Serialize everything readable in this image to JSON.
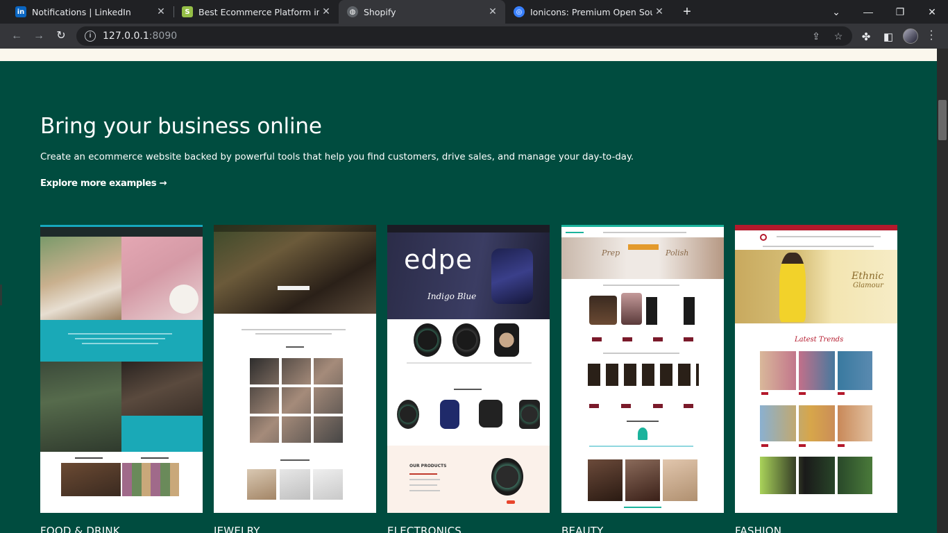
{
  "browser": {
    "tabs": [
      {
        "title": "Notifications | LinkedIn",
        "favicon": "linkedin-icon"
      },
      {
        "title": "Best Ecommerce Platform in India",
        "favicon": "shopify-icon"
      },
      {
        "title": "Shopify",
        "favicon": "globe-icon"
      },
      {
        "title": "Ionicons: Premium Open Source Icons",
        "favicon": "ionicons-icon"
      }
    ],
    "url_host": "127.0.0.1",
    "url_port": ":8090"
  },
  "hero": {
    "headline": "Bring your business online",
    "subline": "Create an ecommerce website backed by powerful tools that help you find customers, drive sales, and manage your day-to-day.",
    "explore_link": "Explore more examples →"
  },
  "examples": [
    {
      "category": "FOOD & DRINK"
    },
    {
      "category": "JEWELRY"
    },
    {
      "category": "ELECTRONICS",
      "hero_brand": "edpe",
      "hero_tag": "Indigo Blue",
      "products_heading": "OUR PRODUCTS"
    },
    {
      "category": "BEAUTY",
      "banner_left": "Prep",
      "banner_right": "Polish"
    },
    {
      "category": "FASHION",
      "banner_text": "Ethnic",
      "banner_sub": "Glamour",
      "section_title": "Latest Trends"
    }
  ],
  "colors": {
    "page_bg": "#004c3f",
    "chrome_dark": "#202124",
    "chrome_toolbar": "#35363a",
    "text_light": "#ffffff"
  }
}
